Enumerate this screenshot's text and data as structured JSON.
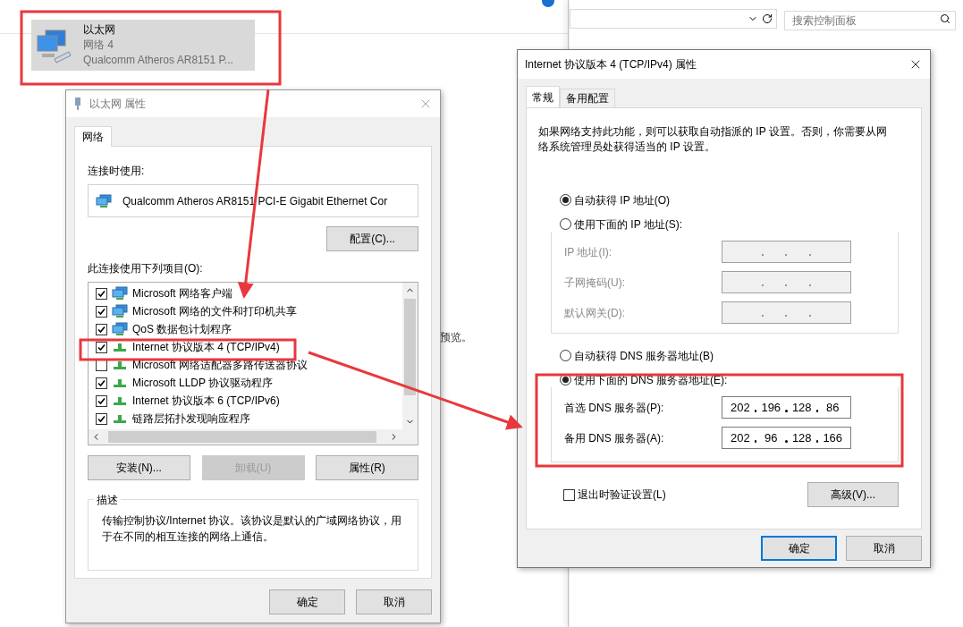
{
  "background_window": {
    "partial_text": "预览。",
    "search": {
      "placeholder": "搜索控制面板"
    }
  },
  "adapter": {
    "name": "以太网",
    "network": "网络 4",
    "device": "Qualcomm Atheros AR8151 P...",
    "selected": true
  },
  "ethernet_dialog": {
    "title": "以太网 属性",
    "tabs": [
      {
        "label": "网络",
        "selected": true
      }
    ],
    "connect_using_label": "连接时使用:",
    "adapter_name": "Qualcomm Atheros AR8151 PCI-E Gigabit Ethernet Cor",
    "configure_button": "配置(C)...",
    "items_label": "此连接使用下列项目(O):",
    "items": [
      {
        "label": "Microsoft 网络客户端",
        "checked": true,
        "kind": "service"
      },
      {
        "label": "Microsoft 网络的文件和打印机共享",
        "checked": true,
        "kind": "service"
      },
      {
        "label": "QoS 数据包计划程序",
        "checked": true,
        "kind": "service"
      },
      {
        "label": "Internet 协议版本 4 (TCP/IPv4)",
        "checked": true,
        "kind": "protocol"
      },
      {
        "label": "Microsoft 网络适配器多路传送器协议",
        "checked": false,
        "kind": "protocol"
      },
      {
        "label": "Microsoft LLDP 协议驱动程序",
        "checked": true,
        "kind": "protocol"
      },
      {
        "label": "Internet 协议版本 6 (TCP/IPv6)",
        "checked": true,
        "kind": "protocol"
      },
      {
        "label": "链路层拓扑发现响应程序",
        "checked": true,
        "kind": "protocol"
      }
    ],
    "buttons": [
      {
        "label": "安装(N)...",
        "disabled": false
      },
      {
        "label": "卸载(U)",
        "disabled": true
      },
      {
        "label": "属性(R)",
        "disabled": false
      }
    ],
    "description_label": "描述",
    "description": "传输控制协议/Internet 协议。该协议是默认的广域网络协议，用于在不同的相互连接的网络上通信。",
    "footer_buttons": [
      "确定",
      "取消"
    ]
  },
  "ipv4_dialog": {
    "title": "Internet 协议版本 4 (TCP/IPv4) 属性",
    "tabs": [
      {
        "label": "常规",
        "selected": true
      },
      {
        "label": "备用配置",
        "selected": false
      }
    ],
    "info": "如果网络支持此功能，则可以获取自动指派的 IP 设置。否则，你需要从网络系统管理员处获得适当的 IP 设置。",
    "ip_modes": [
      {
        "label": "自动获得 IP 地址(O)",
        "selected": true
      },
      {
        "label": "使用下面的 IP 地址(S):",
        "selected": false
      }
    ],
    "ip_fields": [
      {
        "label": "IP 地址(I):",
        "disabled": true
      },
      {
        "label": "子网掩码(U):",
        "disabled": true
      },
      {
        "label": "默认网关(D):",
        "disabled": true
      }
    ],
    "dns_modes": [
      {
        "label": "自动获得 DNS 服务器地址(B)",
        "selected": false
      },
      {
        "label": "使用下面的 DNS 服务器地址(E):",
        "selected": true
      }
    ],
    "dns_fields": [
      {
        "label": "首选 DNS 服务器(P):",
        "disabled": false,
        "octets": [
          "202",
          "196",
          "128",
          "86"
        ]
      },
      {
        "label": "备用 DNS 服务器(A):",
        "disabled": false,
        "octets": [
          "202",
          "96",
          "128",
          "166"
        ]
      }
    ],
    "validate_checkbox": {
      "label": "退出时验证设置(L)",
      "checked": false
    },
    "advanced_button": "高级(V)...",
    "footer_buttons": [
      {
        "label": "确定",
        "default": true
      },
      {
        "label": "取消",
        "default": false
      }
    ]
  }
}
